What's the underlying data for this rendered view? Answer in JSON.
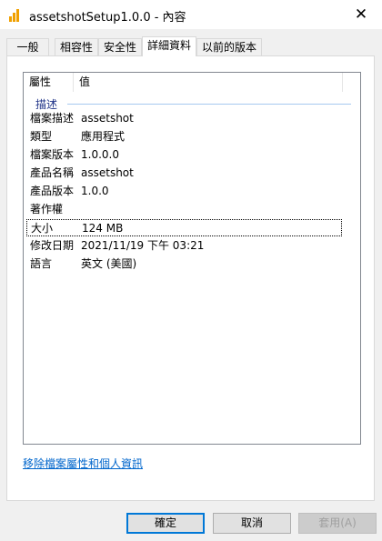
{
  "window": {
    "title": "assetshotSetup1.0.0 - 內容",
    "close_glyph": "✕"
  },
  "tabs": [
    {
      "label": "一般"
    },
    {
      "label": "相容性"
    },
    {
      "label": "安全性"
    },
    {
      "label": "詳細資料",
      "active": true
    },
    {
      "label": "以前的版本"
    }
  ],
  "details": {
    "columns": [
      "屬性",
      "值"
    ],
    "group_label": "描述",
    "rows": [
      {
        "key": "檔案描述",
        "value": "assetshot"
      },
      {
        "key": "類型",
        "value": "應用程式"
      },
      {
        "key": "檔案版本",
        "value": "1.0.0.0"
      },
      {
        "key": "產品名稱",
        "value": "assetshot"
      },
      {
        "key": "產品版本",
        "value": "1.0.0"
      },
      {
        "key": "著作權",
        "value": ""
      },
      {
        "key": "大小",
        "value": "124 MB",
        "selected": true
      },
      {
        "key": "修改日期",
        "value": "2021/11/19 下午 03:21"
      },
      {
        "key": "語言",
        "value": "英文 (美國)"
      }
    ]
  },
  "remove_link": "移除檔案屬性和個人資訊",
  "buttons": {
    "ok": "確定",
    "cancel": "取消",
    "apply": "套用(A)"
  },
  "colors": {
    "accent": "#0078d7",
    "link": "#0066cc",
    "group_label": "#1e3287"
  },
  "icons": {
    "app": "bar-chart-icon",
    "close": "close-icon"
  }
}
